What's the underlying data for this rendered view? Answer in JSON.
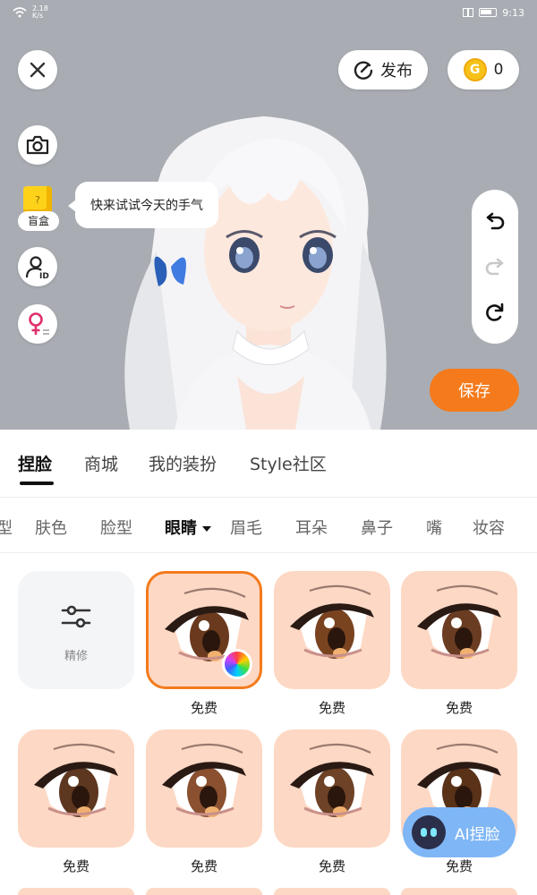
{
  "status_bar": {
    "net_speed_value": "2.18",
    "net_speed_unit": "K/s",
    "time": "9:13"
  },
  "top_controls": {
    "publish_label": "发布",
    "coin_count": "0"
  },
  "left_tools": {
    "blind_box_label": "盲盒",
    "blind_box_mark": "?",
    "bubble_text": "快来试试今天的手气"
  },
  "save_label": "保存",
  "main_tabs": [
    {
      "label": "捏脸",
      "active": true
    },
    {
      "label": "商城",
      "active": false
    },
    {
      "label": "我的装扮",
      "active": false
    },
    {
      "label": "Style社区",
      "active": false
    }
  ],
  "sub_tabs": [
    {
      "label": "型"
    },
    {
      "label": "肤色"
    },
    {
      "label": "脸型"
    },
    {
      "label": "眼睛",
      "active": true
    },
    {
      "label": "眉毛"
    },
    {
      "label": "耳朵"
    },
    {
      "label": "鼻子"
    },
    {
      "label": "嘴"
    },
    {
      "label": "妆容"
    }
  ],
  "grid": {
    "fine_tune_label": "精修",
    "items": [
      {
        "caption": "免费",
        "selected": true,
        "color_wheel": true
      },
      {
        "caption": "免费"
      },
      {
        "caption": "免费"
      },
      {
        "caption": "免费"
      },
      {
        "caption": "免费"
      },
      {
        "caption": "免费"
      },
      {
        "caption": "免费"
      }
    ]
  },
  "ai_button_label": "AI捏脸",
  "colors": {
    "accent": "#f47a1c",
    "tile_bg": "#fdd8c4",
    "scene_bg": "#a9adb3",
    "coin": "#f6c21a",
    "ai_button": "#7fb6f5"
  },
  "icons": [
    "close-icon",
    "camera-icon",
    "id-icon",
    "female-gender-icon",
    "publish-icon",
    "coin-icon",
    "undo-icon",
    "redo-icon",
    "reset-icon",
    "fine-tune-icon",
    "color-wheel-icon",
    "ai-face-icon",
    "wifi-icon",
    "battery-icon",
    "reading-mode-icon"
  ]
}
